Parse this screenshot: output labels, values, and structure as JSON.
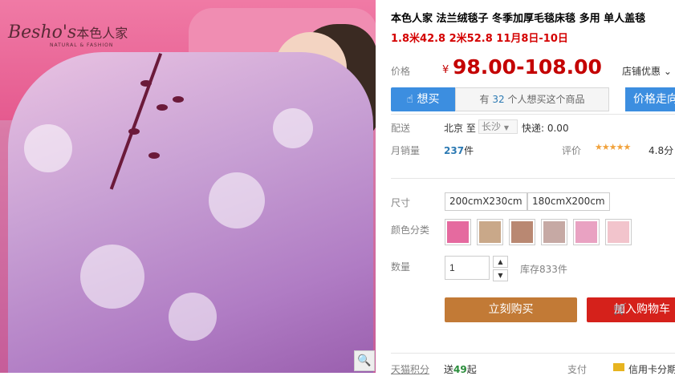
{
  "product": {
    "image_alt_brand": "Besho's",
    "image_brand_cn": "本色人家",
    "image_brand_sub": "NATURAL & FASHION",
    "title": "本色人家 法兰绒毯子 冬季加厚毛毯床毯 多用 单人盖毯",
    "subtitle": "1.8米42.8 2米52.8 11月8日-10日"
  },
  "price": {
    "label": "价格",
    "currency": "¥",
    "value": "98.00-108.00",
    "store_promo": "店铺优惠"
  },
  "want": {
    "button_label": "想买",
    "info_prefix": "有",
    "count": "32",
    "info_suffix": "个人想买这个商品",
    "price_button": "价格走向"
  },
  "shipping": {
    "label": "配送",
    "from": "北京",
    "to_prefix": "至",
    "to": "长沙",
    "fee": "快递: 0.00"
  },
  "sales": {
    "label": "月销量",
    "value": "237",
    "unit": "件",
    "rating_label": "评价",
    "stars": "★★★★★",
    "rating": "4.8分"
  },
  "options": {
    "size_label": "尺寸",
    "sizes": [
      "200cmX230cm",
      "180cmX200cm"
    ],
    "color_label": "颜色分类",
    "swatch_colors": [
      "#e56a9f",
      "#c9a889",
      "#b98872",
      "#c6a9a4",
      "#e9a2c2",
      "#f2c4cc"
    ]
  },
  "quantity": {
    "label": "数量",
    "value": "1",
    "stock": "库存833件"
  },
  "actions": {
    "buy_now": "立刻购买",
    "add_cart": "加入购物车"
  },
  "footer": {
    "points_label": "天猫积分",
    "points_prefix": "送",
    "points_value": "49",
    "points_suffix": "起",
    "pay_label": "支付",
    "pay_value": "信用卡分期"
  }
}
